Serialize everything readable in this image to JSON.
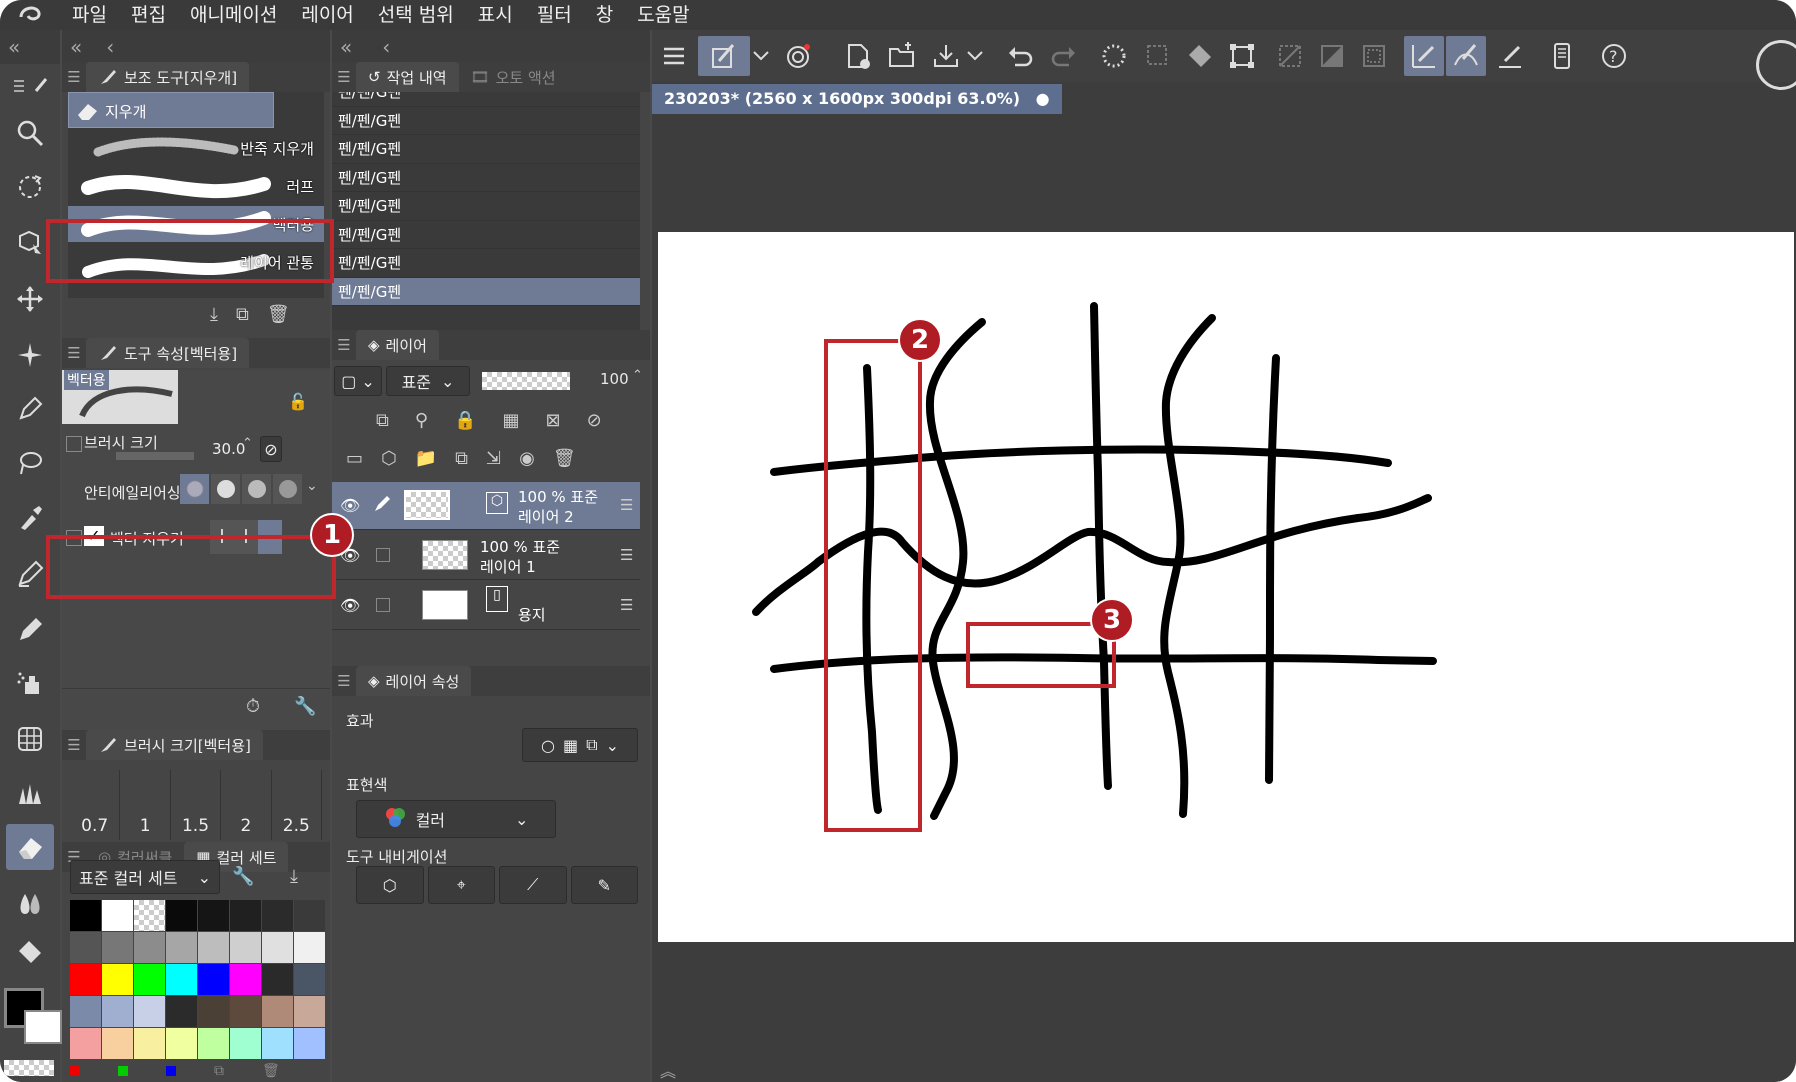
{
  "menubar": {
    "items": [
      "파일",
      "편집",
      "애니메이션",
      "레이어",
      "선택 범위",
      "표시",
      "필터",
      "창",
      "도움말"
    ]
  },
  "subtool_panel": {
    "title": "보조 도구[지우개]",
    "group_label": "지우개",
    "items": [
      {
        "label": "반죽 지우개",
        "selected": false
      },
      {
        "label": "러프",
        "selected": false
      },
      {
        "label": "벡터용",
        "selected": true
      },
      {
        "label": "레이어 관통",
        "selected": false
      }
    ]
  },
  "tool_property": {
    "title": "도구 속성[벡터용]",
    "preview_label": "벡터용",
    "brush_size_label": "브러시 크기",
    "brush_size_value": "30.0",
    "antialias_label": "안티에일리어싱",
    "vector_erase_label": "벡터 지우기",
    "vector_erase_checked": true
  },
  "brush_size_panel": {
    "title": "브러시 크기[벡터용]",
    "sizes": [
      "0.7",
      "1",
      "1.5",
      "2",
      "2.5"
    ]
  },
  "color_panel": {
    "tab_inactive": "컬러써클",
    "tab_active": "컬러 세트",
    "set_name": "표준 컬러 세트",
    "swatches": [
      "#000000",
      "#ffffff",
      "checker",
      "#0a0a0a",
      "#151515",
      "#202020",
      "#2b2b2b",
      "#3a3a3a",
      "#555555",
      "#777777",
      "#8c8c8c",
      "#a6a6a6",
      "#bdbdbd",
      "#cfcfcf",
      "#e0e0e0",
      "#f0f0f0",
      "#ff0000",
      "#ffff00",
      "#00ff00",
      "#00ffff",
      "#0000ff",
      "#ff00ff",
      "#2a2a2a",
      "#4a5566",
      "#7a8aa8",
      "#a0aed0",
      "#c8d0e8",
      "#2b2b2b",
      "#4a4036",
      "#5e4a3c",
      "#b08a78",
      "#c8a898",
      "#f4a0a0",
      "#f8d0a0",
      "#f8f0a0",
      "#f0ffa0",
      "#c0ffa0",
      "#a0ffd0",
      "#a0e0ff",
      "#a0c0ff"
    ],
    "fg_color": "#000000",
    "bg_color": "#ffffff"
  },
  "history_panel": {
    "tab_active": "작업 내역",
    "tab_inactive": "오토 액션",
    "rows": [
      "펜/펜/G펜",
      "펜/펜/G펜",
      "펜/펜/G펜",
      "펜/펜/G펜",
      "펜/펜/G펜",
      "펜/펜/G펜",
      "펜/펜/G펜",
      "펜/펜/G펜"
    ]
  },
  "layer_panel": {
    "title": "레이어",
    "blend_mode": "표준",
    "opacity": "100",
    "layers": [
      {
        "info": "100 % 표준",
        "name": "레이어 2",
        "selected": true
      },
      {
        "info": "100 % 표준",
        "name": "레이어 1",
        "selected": false
      },
      {
        "info": "",
        "name": "용지",
        "selected": false
      }
    ]
  },
  "layer_property": {
    "title": "레이어 속성",
    "effect_label": "효과",
    "display_color_label": "표현색",
    "display_color_value": "컬러",
    "tool_nav_label": "도구 내비게이션"
  },
  "document": {
    "tab_title": "230203* (2560 x 1600px 300dpi 63.0%)"
  },
  "annotations": [
    "1",
    "2",
    "3"
  ],
  "colors": {
    "highlight": "#c0272d",
    "selection": "#6f7b94",
    "panel": "#454545"
  }
}
